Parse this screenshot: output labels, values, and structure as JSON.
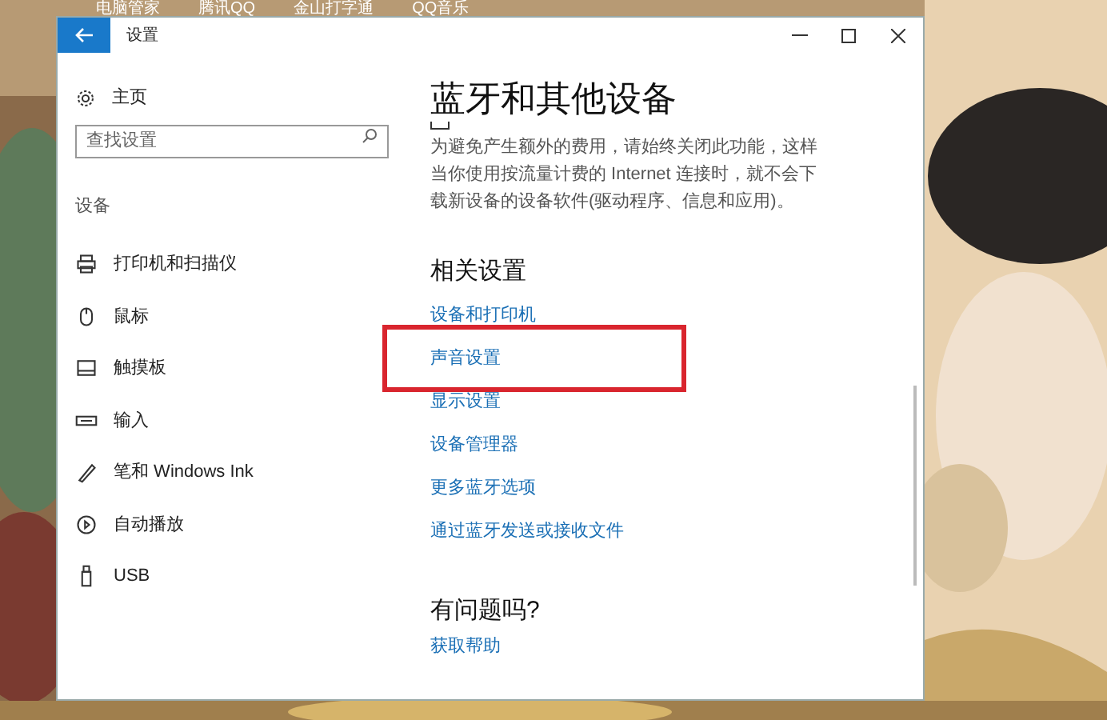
{
  "desktop": {
    "icon_labels": [
      "电脑管家",
      "腾讯QQ",
      "金山打字通",
      "QQ音乐"
    ]
  },
  "window": {
    "title": "设置"
  },
  "sidebar": {
    "home": "主页",
    "search": {
      "placeholder": "查找设置"
    },
    "section": "设备",
    "items": [
      {
        "label": "打印机和扫描仪",
        "kind": "printer"
      },
      {
        "label": "鼠标",
        "kind": "mouse"
      },
      {
        "label": "触摸板",
        "kind": "touchpad"
      },
      {
        "label": "输入",
        "kind": "keyboard"
      },
      {
        "label": "笔和 Windows Ink",
        "kind": "pen"
      },
      {
        "label": "自动播放",
        "kind": "autoplay"
      },
      {
        "label": "USB",
        "kind": "usb"
      }
    ]
  },
  "content": {
    "title": "蓝牙和其他设备",
    "description": "为避免产生额外的费用，请始终关闭此功能，这样当你使用按流量计费的 Internet 连接时，就不会下载新设备的设备软件(驱动程序、信息和应用)。",
    "related_heading": "相关设置",
    "related_links": [
      {
        "label": "设备和打印机",
        "highlighted": false
      },
      {
        "label": "声音设置",
        "highlighted": true
      },
      {
        "label": "显示设置",
        "highlighted": false
      },
      {
        "label": "设备管理器",
        "highlighted": false
      },
      {
        "label": "更多蓝牙选项",
        "highlighted": false
      },
      {
        "label": "通过蓝牙发送或接收文件",
        "highlighted": false
      }
    ],
    "help_heading": "有问题吗?",
    "help_link": "获取帮助"
  }
}
